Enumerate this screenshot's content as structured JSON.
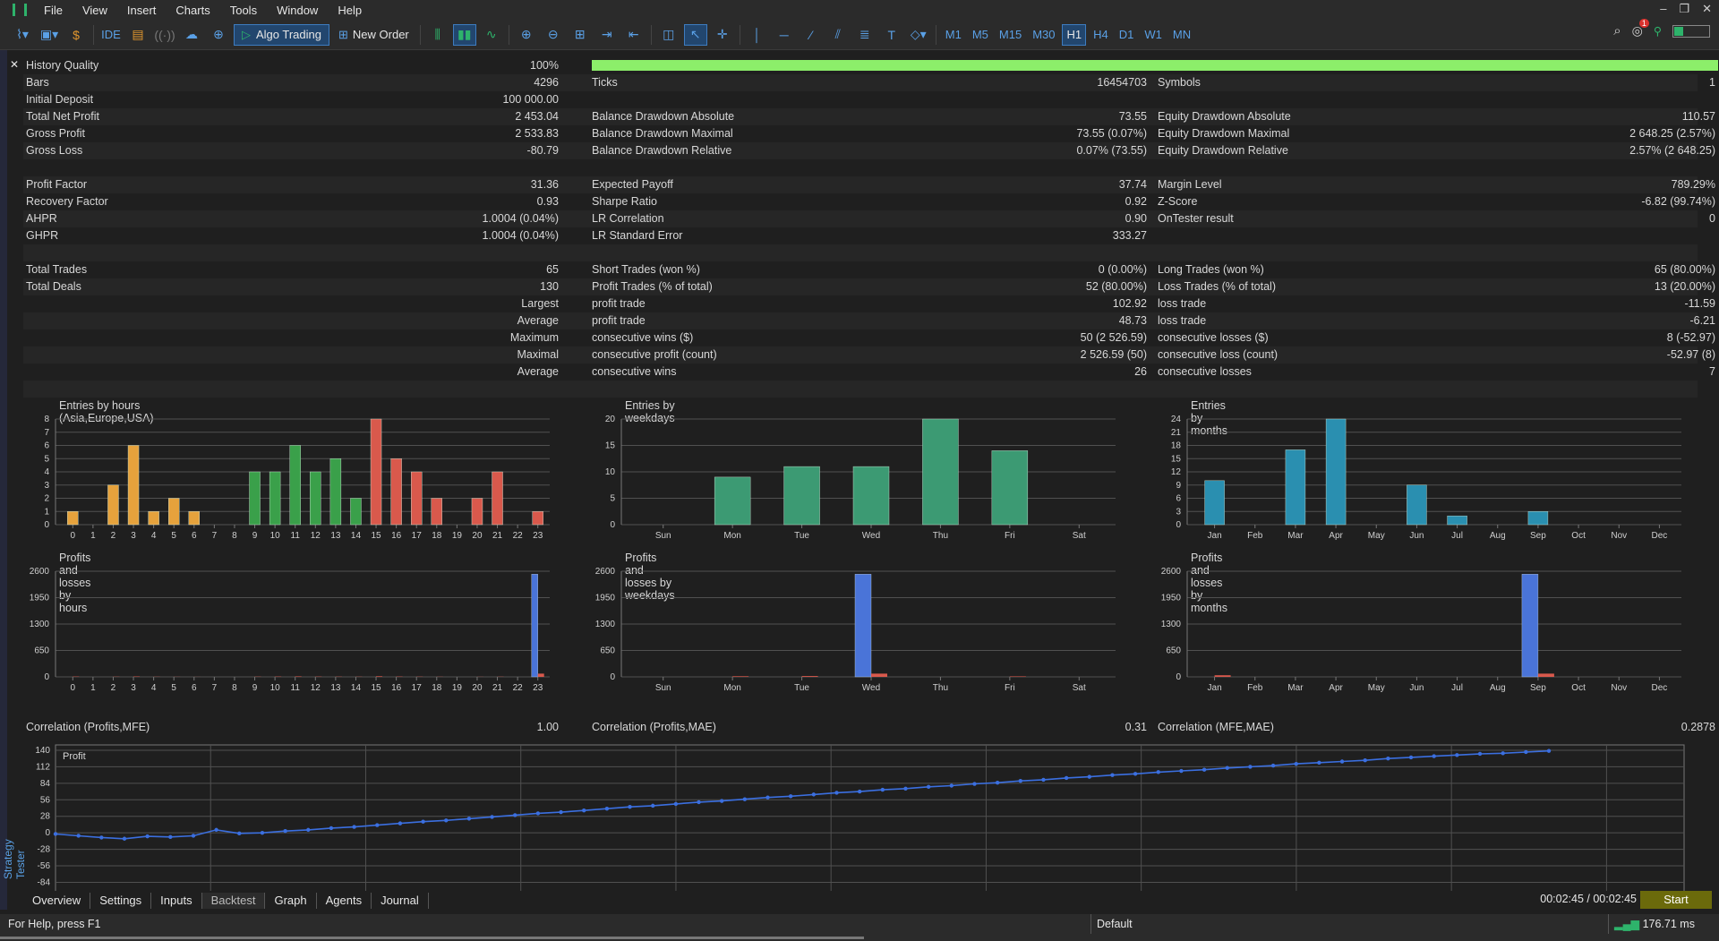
{
  "menu": [
    "File",
    "View",
    "Insert",
    "Charts",
    "Tools",
    "Window",
    "Help"
  ],
  "toolbar": {
    "ide": "IDE",
    "algo": "Algo Trading",
    "new_order": "New Order",
    "timeframes": [
      "M1",
      "M5",
      "M15",
      "M30",
      "H1",
      "H4",
      "D1",
      "W1",
      "MN"
    ],
    "active_tf": "H1",
    "notif_count": "1"
  },
  "window": {
    "min": "–",
    "restore": "❐",
    "close": "✕"
  },
  "side_label": "Strategy Tester",
  "report": {
    "rows": [
      {
        "l1": "History Quality",
        "v1": "100%",
        "hq": true
      },
      {
        "l1": "Bars",
        "v1": "4296",
        "l2": "Ticks",
        "v2": "16454703",
        "l3": "Symbols",
        "v3": "1"
      },
      {
        "l1": "Initial Deposit",
        "v1": "100 000.00"
      },
      {
        "l1": "Total Net Profit",
        "v1": "2 453.04",
        "l2": "Balance Drawdown Absolute",
        "v2": "73.55",
        "l3": "Equity Drawdown Absolute",
        "v3": "110.57"
      },
      {
        "l1": "Gross Profit",
        "v1": "2 533.83",
        "l2": "Balance Drawdown Maximal",
        "v2": "73.55 (0.07%)",
        "l3": "Equity Drawdown Maximal",
        "v3": "2 648.25 (2.57%)"
      },
      {
        "l1": "Gross Loss",
        "v1": "-80.79",
        "l2": "Balance Drawdown Relative",
        "v2": "0.07% (73.55)",
        "l3": "Equity Drawdown Relative",
        "v3": "2.57% (2 648.25)"
      },
      {},
      {
        "l1": "Profit Factor",
        "v1": "31.36",
        "l2": "Expected Payoff",
        "v2": "37.74",
        "l3": "Margin Level",
        "v3": "789.29%"
      },
      {
        "l1": "Recovery Factor",
        "v1": "0.93",
        "l2": "Sharpe Ratio",
        "v2": "0.92",
        "l3": "Z-Score",
        "v3": "-6.82 (99.74%)"
      },
      {
        "l1": "AHPR",
        "v1": "1.0004 (0.04%)",
        "l2": "LR Correlation",
        "v2": "0.90",
        "l3": "OnTester result",
        "v3": "0"
      },
      {
        "l1": "GHPR",
        "v1": "1.0004 (0.04%)",
        "l2": "LR Standard Error",
        "v2": "333.27"
      },
      {},
      {
        "l1": "Total Trades",
        "v1": "65",
        "l2": "Short Trades (won %)",
        "v2": "0 (0.00%)",
        "l3": "Long Trades (won %)",
        "v3": "65 (80.00%)"
      },
      {
        "l1": "Total Deals",
        "v1": "130",
        "l2": "Profit Trades (% of total)",
        "v2": "52 (80.00%)",
        "l3": "Loss Trades (% of total)",
        "v3": "13 (20.00%)"
      },
      {
        "v1": "Largest",
        "l2": "profit trade",
        "v2": "102.92",
        "l3": "loss trade",
        "v3": "-11.59"
      },
      {
        "v1": "Average",
        "l2": "profit trade",
        "v2": "48.73",
        "l3": "loss trade",
        "v3": "-6.21"
      },
      {
        "v1": "Maximum",
        "l2": "consecutive wins ($)",
        "v2": "50 (2 526.59)",
        "l3": "consecutive losses ($)",
        "v3": "8 (-52.97)"
      },
      {
        "v1": "Maximal",
        "l2": "consecutive profit (count)",
        "v2": "2 526.59 (50)",
        "l3": "consecutive loss (count)",
        "v3": "-52.97 (8)"
      },
      {
        "v1": "Average",
        "l2": "consecutive wins",
        "v2": "26",
        "l3": "consecutive losses",
        "v3": "7"
      },
      {}
    ]
  },
  "colors": {
    "orange": "#e6a23c",
    "green": "#3aa04a",
    "red": "#d9594c",
    "teal": "#3c9a73",
    "cyan": "#2a8fb0",
    "blue": "#4a74d8",
    "loss": "#d9594c",
    "grid": "#555555",
    "profit_line": "#3b6fe0"
  },
  "chart_data": [
    {
      "type": "bar",
      "title": "Entries by hours (Asia,Europe,USA)",
      "categories": [
        "0",
        "1",
        "2",
        "3",
        "4",
        "5",
        "6",
        "7",
        "8",
        "9",
        "10",
        "11",
        "12",
        "13",
        "14",
        "15",
        "16",
        "17",
        "18",
        "19",
        "20",
        "21",
        "22",
        "23"
      ],
      "values": [
        1,
        0,
        3,
        6,
        1,
        2,
        1,
        0,
        0,
        4,
        4,
        6,
        4,
        5,
        2,
        8,
        5,
        4,
        2,
        0,
        2,
        4,
        0,
        1
      ],
      "yticks": [
        0,
        1,
        2,
        3,
        4,
        5,
        6,
        7,
        8
      ],
      "ylim": [
        0,
        8
      ]
    },
    {
      "type": "bar",
      "title": "Entries by weekdays",
      "categories": [
        "Sun",
        "Mon",
        "Tue",
        "Wed",
        "Thu",
        "Fri",
        "Sat"
      ],
      "values": [
        0,
        9,
        11,
        11,
        20,
        14,
        0
      ],
      "yticks": [
        0,
        5,
        10,
        15,
        20
      ],
      "ylim": [
        0,
        20
      ]
    },
    {
      "type": "bar",
      "title": "Entries by months",
      "categories": [
        "Jan",
        "Feb",
        "Mar",
        "Apr",
        "May",
        "Jun",
        "Jul",
        "Aug",
        "Sep",
        "Oct",
        "Nov",
        "Dec"
      ],
      "values": [
        10,
        0,
        17,
        24,
        0,
        9,
        2,
        0,
        3,
        0,
        0,
        0
      ],
      "yticks": [
        0,
        3,
        6,
        9,
        12,
        15,
        18,
        21,
        24
      ],
      "ylim": [
        0,
        24
      ]
    },
    {
      "type": "bar",
      "title": "Profits and losses by hours",
      "categories": [
        "0",
        "1",
        "2",
        "3",
        "4",
        "5",
        "6",
        "7",
        "8",
        "9",
        "10",
        "11",
        "12",
        "13",
        "14",
        "15",
        "16",
        "17",
        "18",
        "19",
        "20",
        "21",
        "22",
        "23"
      ],
      "series": [
        {
          "values": [
            0,
            0,
            0,
            0,
            0,
            0,
            0,
            0,
            0,
            0,
            0,
            0,
            0,
            0,
            0,
            0,
            0,
            0,
            0,
            0,
            0,
            0,
            0,
            2527
          ]
        },
        {
          "values": [
            8,
            0,
            5,
            10,
            4,
            3,
            2,
            0,
            0,
            6,
            8,
            12,
            7,
            6,
            5,
            15,
            8,
            6,
            4,
            0,
            3,
            5,
            0,
            80
          ]
        }
      ],
      "yticks": [
        0,
        650,
        1300,
        1950,
        2600
      ],
      "ylim": [
        0,
        2600
      ]
    },
    {
      "type": "bar",
      "title": "Profits and losses by weekdays",
      "categories": [
        "Sun",
        "Mon",
        "Tue",
        "Wed",
        "Thu",
        "Fri",
        "Sat"
      ],
      "series": [
        {
          "values": [
            0,
            0,
            0,
            2527,
            0,
            0,
            0
          ]
        },
        {
          "values": [
            0,
            15,
            20,
            80,
            0,
            12,
            0
          ]
        }
      ],
      "yticks": [
        0,
        650,
        1300,
        1950,
        2600
      ],
      "ylim": [
        0,
        2600
      ]
    },
    {
      "type": "bar",
      "title": "Profits and losses by months",
      "categories": [
        "Jan",
        "Feb",
        "Mar",
        "Apr",
        "May",
        "Jun",
        "Jul",
        "Aug",
        "Sep",
        "Oct",
        "Nov",
        "Dec"
      ],
      "series": [
        {
          "values": [
            0,
            0,
            0,
            0,
            0,
            0,
            0,
            0,
            2527,
            0,
            0,
            0
          ]
        },
        {
          "values": [
            40,
            0,
            0,
            0,
            0,
            0,
            0,
            0,
            80,
            0,
            0,
            0
          ]
        }
      ],
      "yticks": [
        0,
        650,
        1300,
        1950,
        2600
      ],
      "ylim": [
        0,
        2600
      ]
    },
    {
      "type": "line",
      "title": "Profit",
      "x": [
        0,
        1,
        2,
        3,
        4,
        5,
        6,
        7,
        8,
        9,
        10,
        11,
        12,
        13,
        14,
        15,
        16,
        17,
        18,
        19,
        20,
        21,
        22,
        23,
        24,
        25,
        26,
        27,
        28,
        29,
        30,
        31,
        32,
        33,
        34,
        35,
        36,
        37,
        38,
        39,
        40,
        41,
        42,
        43,
        44,
        45,
        46,
        47,
        48,
        49,
        50,
        51,
        52,
        53,
        54,
        55,
        56,
        57,
        58,
        59,
        60,
        61,
        62,
        63,
        64,
        65
      ],
      "values": [
        -2,
        -5,
        -8,
        -10,
        -6,
        -7,
        -5,
        5,
        -1,
        0,
        3,
        5,
        8,
        10,
        13,
        16,
        19,
        21,
        24,
        27,
        30,
        33,
        35,
        38,
        41,
        44,
        46,
        49,
        52,
        54,
        57,
        60,
        62,
        65,
        68,
        70,
        73,
        75,
        78,
        80,
        83,
        85,
        88,
        90,
        93,
        95,
        98,
        100,
        103,
        105,
        107,
        110,
        112,
        114,
        117,
        119,
        121,
        123,
        126,
        128,
        130,
        132,
        134,
        135,
        137,
        139
      ],
      "yticks": [
        -84,
        -56,
        -28,
        0,
        28,
        56,
        84,
        112,
        140
      ],
      "ylim": [
        -100,
        140
      ]
    }
  ],
  "correlations": [
    {
      "label": "Correlation (Profits,MFE)",
      "value": "1.00"
    },
    {
      "label": "Correlation (Profits,MAE)",
      "value": "0.31"
    },
    {
      "label": "Correlation (MFE,MAE)",
      "value": "0.2878"
    }
  ],
  "tabs": [
    "Overview",
    "Settings",
    "Inputs",
    "Backtest",
    "Graph",
    "Agents",
    "Journal"
  ],
  "active_tab": "Backtest",
  "timer": "00:02:45 / 00:02:45",
  "start_label": "Start",
  "status": {
    "help": "For Help, press F1",
    "profile": "Default",
    "ping": "176.71 ms"
  }
}
